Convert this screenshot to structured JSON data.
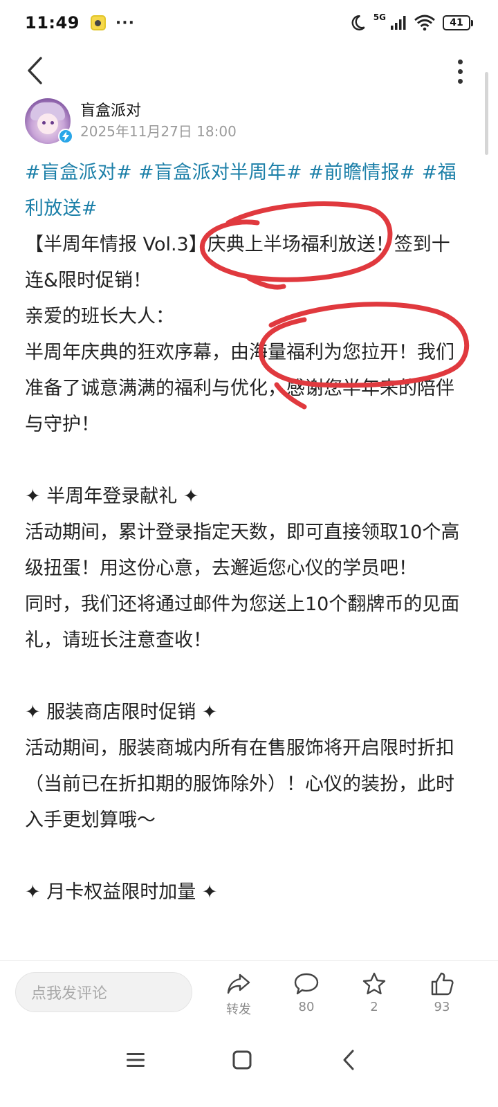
{
  "status_bar": {
    "time": "11:49",
    "more": "···",
    "network": "5G",
    "battery": "41"
  },
  "author": {
    "name": "盲盒派对",
    "time": "2025年11月27日 18:00"
  },
  "post": {
    "topics": [
      "#盲盒派对#",
      "#盲盒派对半周年#",
      "#前瞻情报#",
      "#福利放送#"
    ],
    "title": "【半周年情报 Vol.3】庆典上半场福利放送！签到十连&限时促销！",
    "greeting": "亲爱的班长大人：",
    "intro": "半周年庆典的狂欢序幕，由海量福利为您拉开！我们准备了诚意满满的福利与优化，感谢您半年来的陪伴与守护！",
    "sections": [
      {
        "heading": "✦ 半周年登录献礼 ✦",
        "paragraphs": [
          "活动期间，累计登录指定天数，即可直接领取10个高级扭蛋！用这份心意，去邂逅您心仪的学员吧！",
          "同时，我们还将通过邮件为您送上10个翻牌币的见面礼，请班长注意查收！"
        ]
      },
      {
        "heading": "✦ 服装商店限时促销 ✦",
        "paragraphs": [
          "活动期间，服装商城内所有在售服饰将开启限时折扣（当前已在折扣期的服饰除外）！心仪的装扮，此时入手更划算哦～"
        ]
      },
      {
        "heading": "✦ 月卡权益限时加量 ✦",
        "paragraphs": []
      }
    ]
  },
  "action_bar": {
    "comment_placeholder": "点我发评论",
    "share_label": "转发",
    "comment_count": "80",
    "favorite_count": "2",
    "like_count": "93"
  },
  "colors": {
    "topic": "#1b7fa8",
    "annotation": "#e0393e",
    "verified": "#2aa6e8"
  },
  "icons": [
    "back-icon",
    "more-vertical-icon",
    "share-icon",
    "comment-icon",
    "star-icon",
    "like-icon",
    "menu-icon",
    "home-icon",
    "nav-back-icon"
  ]
}
